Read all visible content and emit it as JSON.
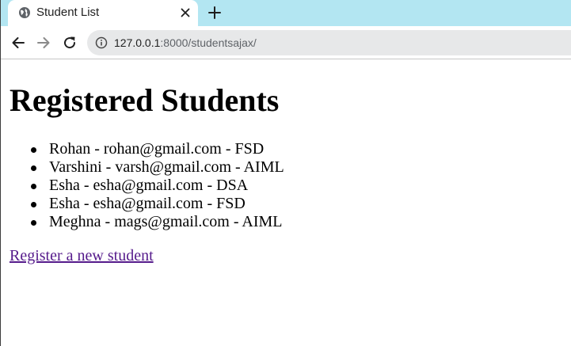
{
  "browser": {
    "tab": {
      "title": "Student List"
    },
    "address": {
      "host": "127.0.0.1",
      "rest": ":8000/studentsajax/"
    }
  },
  "page": {
    "title": "Registered Students",
    "students": [
      {
        "text": "Rohan - rohan@gmail.com - FSD"
      },
      {
        "text": "Varshini - varsh@gmail.com - AIML"
      },
      {
        "text": "Esha - esha@gmail.com - DSA"
      },
      {
        "text": "Esha - esha@gmail.com - FSD"
      },
      {
        "text": "Meghna - mags@gmail.com - AIML"
      }
    ],
    "register_link": "Register a new student"
  },
  "icons": {
    "favicon": "globe-icon",
    "close": "close-icon",
    "new_tab": "plus-icon",
    "back": "arrow-left-icon",
    "forward": "arrow-right-icon",
    "reload": "reload-icon",
    "site_info": "info-icon"
  },
  "colors": {
    "tabstrip": "#b3e6f2",
    "omnibox": "#e7e8e9",
    "visited_link": "#551a8b"
  }
}
